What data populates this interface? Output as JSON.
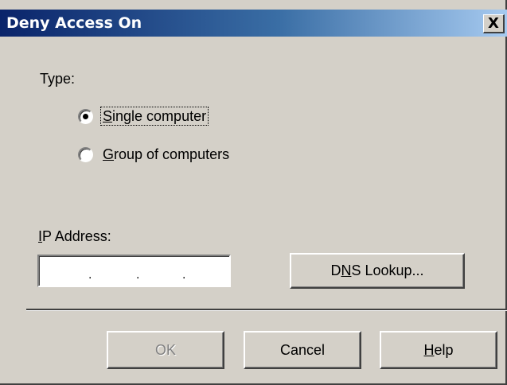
{
  "window": {
    "title": "Deny Access On",
    "close_glyph": "X"
  },
  "type_group": {
    "label": "Type:",
    "options": [
      {
        "label": "Single computer",
        "mnemonic": "S",
        "selected": true
      },
      {
        "label": "Group of computers",
        "mnemonic": "G",
        "selected": false
      }
    ]
  },
  "ip": {
    "label": "IP Address:",
    "mnemonic": "I",
    "value": ". . ."
  },
  "buttons": {
    "dns_lookup": "DNS Lookup...",
    "dns_mnemonic": "N",
    "ok": "OK",
    "ok_enabled": false,
    "cancel": "Cancel",
    "help": "Help",
    "help_mnemonic": "H"
  },
  "icons": {
    "close": "close-icon",
    "radio_selected": "radio-selected-icon",
    "radio_unselected": "radio-unselected-icon"
  },
  "colors": {
    "dialog_face": "#d4d0c8",
    "titlebar_start": "#0a246a",
    "titlebar_end": "#a6caf0",
    "title_text": "#ffffff",
    "disabled_text": "#808080"
  }
}
